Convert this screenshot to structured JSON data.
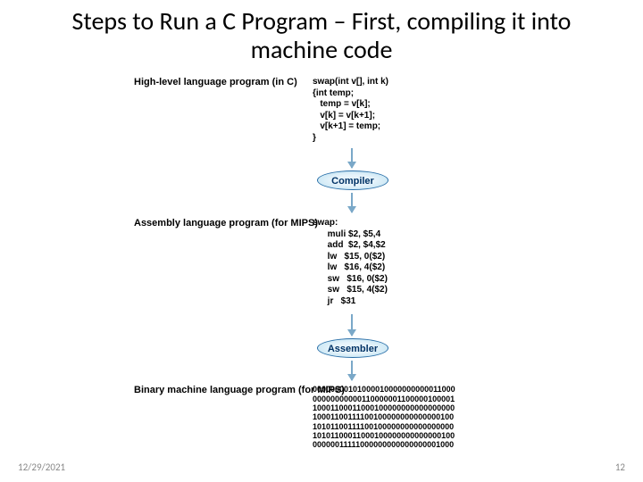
{
  "title": "Steps to Run a C Program – First, compiling it into machine code",
  "footer": {
    "date": "12/29/2021",
    "page": "12"
  },
  "labels": {
    "hll": "High-level\nlanguage\nprogram\n(in C)",
    "asm": "Assembly\nlanguage\nprogram\n(for MIPS)",
    "bin": "Binary machine\nlanguage\nprogram\n(for MIPS)"
  },
  "code": {
    "hll": "swap(int v[], int k)\n{int temp;\n   temp = v[k];\n   v[k] = v[k+1];\n   v[k+1] = temp;\n}",
    "asm": "swap:\n      muli $2, $5,4\n      add  $2, $4,$2\n      lw   $15, 0($2)\n      lw   $16, 4($2)\n      sw   $16, 0($2)\n      sw   $15, 4($2)\n      jr   $31",
    "bin": "00000000101000010000000000011000\n00000000000110000001100000100001\n10001100011000100000000000000000\n10001100111100100000000000000100\n10101100111100100000000000000000\n10101100011000100000000000000100\n00000011111000000000000000001000"
  },
  "stages": {
    "compiler": "Compiler",
    "assembler": "Assembler"
  },
  "chart_data": {
    "type": "diagram",
    "flow": [
      {
        "node": "High-level language program (in C)",
        "content_ref": "code.hll"
      },
      {
        "edge": "Compiler"
      },
      {
        "node": "Assembly language program (for MIPS)",
        "content_ref": "code.asm"
      },
      {
        "edge": "Assembler"
      },
      {
        "node": "Binary machine language program (for MIPS)",
        "content_ref": "code.bin"
      }
    ]
  }
}
